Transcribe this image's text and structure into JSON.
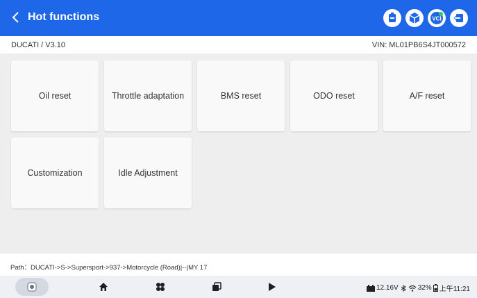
{
  "header": {
    "title": "Hot functions",
    "icons": [
      "battery-app-icon",
      "package-icon",
      "vci-icon",
      "exit-icon"
    ],
    "vci_label": "VCI"
  },
  "subheader": {
    "vehicle_version": "DUCATI / V3.10",
    "vin": "VIN: ML01PB6S4JT000572"
  },
  "functions": [
    "Oil reset",
    "Throttle adaptation",
    "BMS reset",
    "ODO reset",
    "A/F reset",
    "Customization",
    "Idle Adjustment"
  ],
  "path": "Path：DUCATI->S->Supersport->937->Motorcycle (Road)|--|MY 17",
  "status": {
    "voltage": "12.16V",
    "battery": "32%",
    "time": "上午11:21"
  },
  "colors": {
    "accent": "#1d67e8",
    "content_bg": "#eeeeee"
  }
}
